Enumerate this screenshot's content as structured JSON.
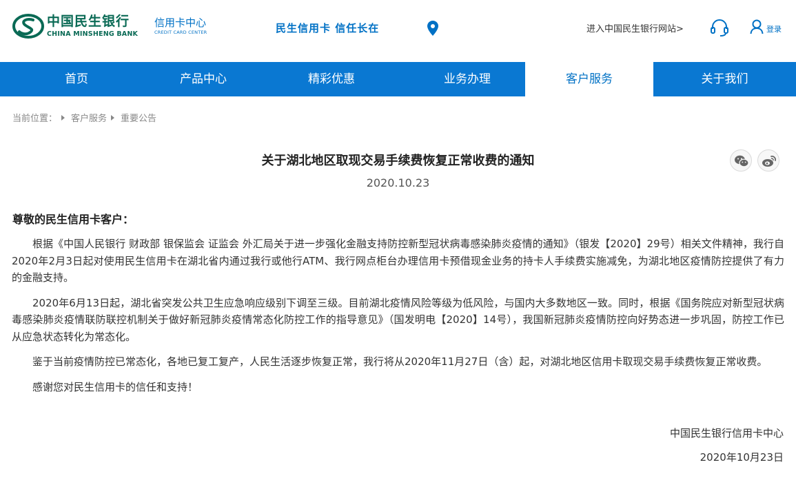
{
  "header": {
    "logo_cn": "中国民生银行",
    "logo_en": "CHINA MINSHENG BANK",
    "center_cn": "信用卡中心",
    "center_en": "CREDIT CARD CENTER",
    "slogan": "民生信用卡 信任长在",
    "enter_link": "进入中国民生银行网站>",
    "login_label": "登录",
    "icons": [
      "location-icon",
      "headset-support-icon",
      "user-icon"
    ],
    "brand_color": "#0a6a55",
    "accent_color": "#0071c5"
  },
  "nav": {
    "items": [
      {
        "label": "首页"
      },
      {
        "label": "产品中心"
      },
      {
        "label": "精彩优惠"
      },
      {
        "label": "业务办理"
      },
      {
        "label": "客户服务"
      },
      {
        "label": "关于我们"
      }
    ],
    "active": "客户服务",
    "bg_color": "#0a78d2"
  },
  "breadcrumb": {
    "prefix": "当前位置：",
    "items": [
      "客户服务",
      "重要公告"
    ]
  },
  "article": {
    "title": "关于湖北地区取现交易手续费恢复正常收费的通知",
    "date": "2020.10.23",
    "share_icons": [
      "wechat-icon",
      "weibo-icon"
    ],
    "greeting": "尊敬的民生信用卡客户：",
    "paragraphs": [
      "根据《中国人民银行 财政部 银保监会 证监会 外汇局关于进一步强化金融支持防控新型冠状病毒感染肺炎疫情的通知》（银发【2020】29号）相关文件精神，我行自2020年2月3日起对使用民生信用卡在湖北省内通过我行或他行ATM、我行网点柜台办理信用卡预借现金业务的持卡人手续费实施减免，为湖北地区疫情防控提供了有力的金融支持。",
      "2020年6月13日起，湖北省突发公共卫生应急响应级别下调至三级。目前湖北疫情风险等级为低风险，与国内大多数地区一致。同时，根据《国务院应对新型冠状病毒感染肺炎疫情联防联控机制关于做好新冠肺炎疫情常态化防控工作的指导意见》（国发明电【2020】14号），我国新冠肺炎疫情防控向好势态进一步巩固，防控工作已从应急状态转化为常态化。",
      "鉴于当前疫情防控已常态化，各地已复工复产，人民生活逐步恢复正常，我行将从2020年11月27日（含）起，对湖北地区信用卡取现交易手续费恢复正常收费。",
      "感谢您对民生信用卡的信任和支持！"
    ],
    "sign_org": "中国民生银行信用卡中心",
    "sign_date": "2020年10月23日"
  }
}
